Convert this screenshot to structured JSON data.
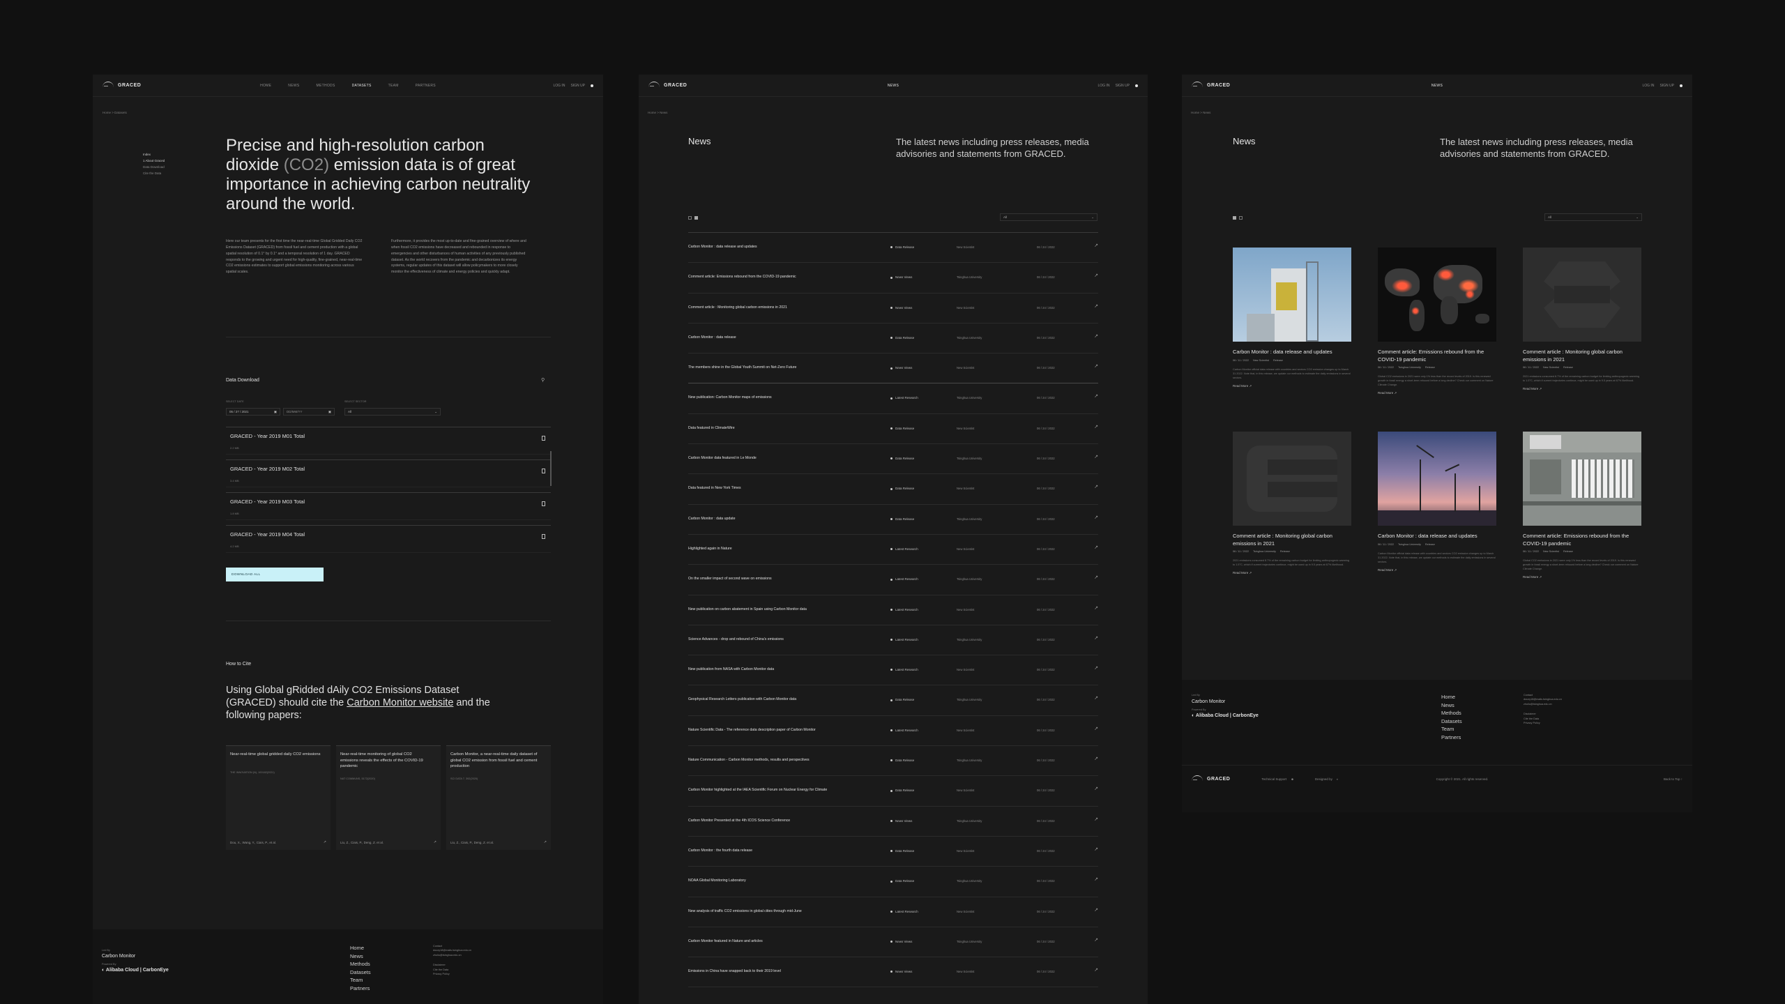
{
  "nav": {
    "brand": "GRACED",
    "links": [
      "HOME",
      "NEWS",
      "METHODS",
      "DATASETS",
      "TEAM",
      "PARTNERS"
    ],
    "center_news": "NEWS",
    "login": "LOG IN",
    "signup": "SIGN UP"
  },
  "frame1": {
    "breadcrumb": "Home > Datasets",
    "toc": {
      "title": "Index",
      "items": [
        "1 About Graced",
        "Data Download",
        "Cite the Data"
      ]
    },
    "hero_before": "Precise and high-resolution carbon dioxide ",
    "hero_highlight": "(CO2)",
    "hero_after": " emission data is of great importance in achieving carbon neutrality around the world.",
    "para_left": "Here our team presents for the first time the near-real-time Global Gridded Daily CO2 Emissions Dataset (GRACED) from fossil fuel and cement production with a global spatial resolution of 0.1° by 0.1° and a temporal resolution of 1 day. GRACED responds to the growing and urgent need for high-quality, fine-grained, near-real-time CO2 emissions estimates to support global emissions monitoring across various spatial scales.",
    "para_right": "Furthermore, it provides the most up-to-date and fine-grained overview of where and when fossil CO2 emissions have decreased and rebounded in response to emergencies and other disturbances of human activities of any previously published dataset. As the world recovers from the pandemic and decarbonizes its energy systems, regular updates of this dataset will allow policymakers to more closely monitor the effectiveness of climate and energy policies and quickly adapt.",
    "download": {
      "title": "Data Download",
      "date_label": "SELECT DATE",
      "date_from": "05 / 27 / 2021",
      "date_to": "DD/MM/YY",
      "sector_label": "SELECT SECTOR",
      "sector_value": "All",
      "rows": [
        {
          "title": "GRACED - Year 2019 M01 Total",
          "size": "2.2 MB"
        },
        {
          "title": "GRACED - Year 2019 M02 Total",
          "size": "3.4 MB"
        },
        {
          "title": "GRACED - Year 2019 M03 Total",
          "size": "1.8 MB"
        },
        {
          "title": "GRACED - Year 2019 M04 Total",
          "size": "4.2 MB"
        }
      ],
      "button": "DOWNLOAD ALL"
    },
    "cite": {
      "title": "How to Cite",
      "text_before": "Using Global gRidded dAily CO2 Emissions Dataset (GRACED) should cite the ",
      "link": "Carbon Monitor website",
      "text_after": " and the following papers:",
      "papers": [
        {
          "title": "Near-real-time global gridded daily CO2 emissions",
          "journal": "THE INNOVATION (N), 100182(2021)",
          "authors": "Dou, X., Wang, Y., Ciais, P., et al."
        },
        {
          "title": "Near-real-time monitoring of global CO2 emissions reveals the effects of the COVID-19 pandemic",
          "journal": "NAT COMMUNS, 5172(2020)",
          "authors": "Liu, Z., Ciais, P., Deng, Z. et al."
        },
        {
          "title": "Carbon Monitor, a near-real-time daily dataset of global CO2 emission from fossil fuel and cement production",
          "journal": "SCI DATA 7, 392(2020)",
          "authors": "Liu, Z., Ciais, P., Deng, Z. et al."
        }
      ]
    }
  },
  "footer": {
    "lead_by_label": "Led By",
    "lead_by": "Carbon Monitor",
    "powered_label": "Powered By",
    "partner1": "Alibaba Cloud",
    "partner2": "CarbonEye",
    "links": [
      "Home",
      "News",
      "Methods",
      "Datasets",
      "Team",
      "Partners"
    ],
    "contact_label": "Contact",
    "contact1": "douxy18@mails.tsinghua.edu.cn",
    "contact2": "zhuliu@tsinghua.edu.cn",
    "disclaimer_label": "Disclaimer",
    "disclaimer1": "Cite the Data",
    "disclaimer2": "Privacy Policy",
    "tech_support": "Technical Support",
    "designed_by": "Designed by",
    "copyright": "Copyright © 2021. All rights reserved.",
    "back_to_top": "Back to Top"
  },
  "news": {
    "breadcrumb": "Home > News",
    "title": "News",
    "description": "The latest news including press releases, media advisories and statements from GRACED.",
    "filter": "All",
    "items": [
      {
        "title": "Carbon Monitor : data release and updates",
        "cat": "Data Release",
        "src": "New Scientist",
        "date": "06 / 24 / 2022"
      },
      {
        "title": "Comment article: Emissions rebound from the COVID-19 pandemic",
        "cat": "News Views",
        "src": "Tsinghua University",
        "date": "06 / 24 / 2022"
      },
      {
        "title": "Comment article : Monitoring global carbon emissions in 2021",
        "cat": "News Views",
        "src": "New Scientist",
        "date": "06 / 24 / 2022"
      },
      {
        "title": "Carbon Monitor : data release",
        "cat": "Data Release",
        "src": "Tsinghua University",
        "date": "06 / 24 / 2022"
      },
      {
        "title": "The members shine in the Global Youth Summit on Net-Zero Future",
        "cat": "News Views",
        "src": "New Scientist",
        "date": "06 / 24 / 2022"
      },
      {
        "title": "New publication: Carbon Monitor maps of emissions",
        "cat": "Latest Research",
        "src": "Tsinghua University",
        "date": "06 / 24 / 2022"
      },
      {
        "title": "Data featured in ClimateWire",
        "cat": "Data Release",
        "src": "New Scientist",
        "date": "06 / 24 / 2022"
      },
      {
        "title": "Carbon Monitor data featured in Le Monde",
        "cat": "Data Release",
        "src": "Tsinghua University",
        "date": "06 / 24 / 2022"
      },
      {
        "title": "Data featured in New York Times",
        "cat": "Data Release",
        "src": "New Scientist",
        "date": "06 / 24 / 2022"
      },
      {
        "title": "Carbon Monitor : data update",
        "cat": "Data Release",
        "src": "Tsinghua University",
        "date": "06 / 24 / 2022"
      },
      {
        "title": "Highlighted again in Nature",
        "cat": "Latest Research",
        "src": "New Scientist",
        "date": "06 / 24 / 2022"
      },
      {
        "title": "On the smaller impact of second wave on emissions",
        "cat": "Latest Research",
        "src": "Tsinghua University",
        "date": "06 / 24 / 2022"
      },
      {
        "title": "New publication on carbon abatement in Spain using Carbon Monitor data",
        "cat": "Latest Research",
        "src": "New Scientist",
        "date": "06 / 24 / 2022"
      },
      {
        "title": "Science Advances - drop and rebound of China's emissions",
        "cat": "Latest Research",
        "src": "Tsinghua University",
        "date": "06 / 24 / 2022"
      },
      {
        "title": "New publication from NASA with Carbon Monitor data",
        "cat": "Latest Research",
        "src": "New Scientist",
        "date": "06 / 24 / 2022"
      },
      {
        "title": "Geophysical Research Letters publication with Carbon Monitor data",
        "cat": "Data Release",
        "src": "Tsinghua University",
        "date": "06 / 24 / 2022"
      },
      {
        "title": "Nature Scientific Data - The reference data description paper of Carbon Monitor",
        "cat": "Latest Research",
        "src": "New Scientist",
        "date": "06 / 24 / 2022"
      },
      {
        "title": "Nature Communication - Carbon Monitor methods, results and perspectives",
        "cat": "Data Release",
        "src": "Tsinghua University",
        "date": "06 / 24 / 2022"
      },
      {
        "title": "Carbon Monitor highlighted at the IAEA Scientific Forum on Nuclear Energy for Climate",
        "cat": "Data Release",
        "src": "New Scientist",
        "date": "06 / 24 / 2022"
      },
      {
        "title": "Carbon Monitor Presented at the 4th ICOS Science Conference",
        "cat": "News Views",
        "src": "Tsinghua University",
        "date": "06 / 24 / 2022"
      },
      {
        "title": "Carbon Monitor : the fourth data release",
        "cat": "Data Release",
        "src": "New Scientist",
        "date": "06 / 24 / 2022"
      },
      {
        "title": "NOAA Global Monitoring Laboratory",
        "cat": "Data Release",
        "src": "Tsinghua University",
        "date": "06 / 24 / 2022"
      },
      {
        "title": "New analysis of traffic CO2 emissions in global cities through mid-June",
        "cat": "Latest Research",
        "src": "New Scientist",
        "date": "06 / 24 / 2022"
      },
      {
        "title": "Carbon Monitor featured in Nature and articles",
        "cat": "News Views",
        "src": "Tsinghua University",
        "date": "06 / 24 / 2022"
      },
      {
        "title": "Emissions in China have snapped back to their 2019 level",
        "cat": "News Views",
        "src": "New Scientist",
        "date": "06 / 24 / 2022"
      }
    ]
  },
  "grid": {
    "read_more": "Read More",
    "cards": [
      {
        "title": "Carbon Monitor : data release and updates",
        "date": "06 / 11 / 2022",
        "src": "New Scientist",
        "cat": "Release",
        "excerpt": "Carbon Monitor official data release with countries and sectors CO2 emission changes up to March 31 2022. Note that, in this release, we update our methods to estimate the daily emissions in several sectors."
      },
      {
        "title": "Comment article: Emissions rebound from the COVID-19 pandemic",
        "date": "06 / 11 / 2022",
        "src": "Tsinghua University",
        "cat": "Release",
        "excerpt": "Global CO2 emissions in 2021 were only 1% less than the record levels of 2019. Is this renewed growth in fossil energy a short-term rebound before a long decline? Check our comment on Nature Climate Change."
      },
      {
        "title": "Comment article : Monitoring global carbon emissions in 2021",
        "date": "06 / 11 / 2022",
        "src": "New Scientist",
        "cat": "Release",
        "excerpt": "2021 emissions consumed 8.7% of the remaining carbon budget for limiting anthropogenic warming to 1.5°C, which if current trajectories continue, might be used up in 9.5 years at 67% likelihood."
      },
      {
        "title": "Comment article : Monitoring global carbon emissions in 2021",
        "date": "06 / 11 / 2022",
        "src": "Tsinghua University",
        "cat": "Release",
        "excerpt": "2021 emissions consumed 8.7% of the remaining carbon budget for limiting anthropogenic warming to 1.5°C, which if current trajectories continue, might be used up in 9.5 years at 67% likelihood."
      },
      {
        "title": "Carbon Monitor : data release and updates",
        "date": "06 / 11 / 2022",
        "src": "Tsinghua University",
        "cat": "Release",
        "excerpt": "Carbon Monitor official data release with countries and sectors CO2 emission changes up to March 31 2022. Note that, in this release, we update our methods to estimate the daily emissions in several sectors."
      },
      {
        "title": "Comment article: Emissions rebound from the COVID-19 pandemic",
        "date": "06 / 11 / 2022",
        "src": "New Scientist",
        "cat": "Release",
        "excerpt": "Global CO2 emissions in 2021 were only 1% less than the record levels of 2019. Is this renewed growth in fossil energy a short-term rebound before a long decline? Check our comment on Nature Climate Change."
      }
    ]
  },
  "colors": {
    "bg": "#111111",
    "panel": "#1a1a1a",
    "accent_button": "#c9f1f8"
  }
}
